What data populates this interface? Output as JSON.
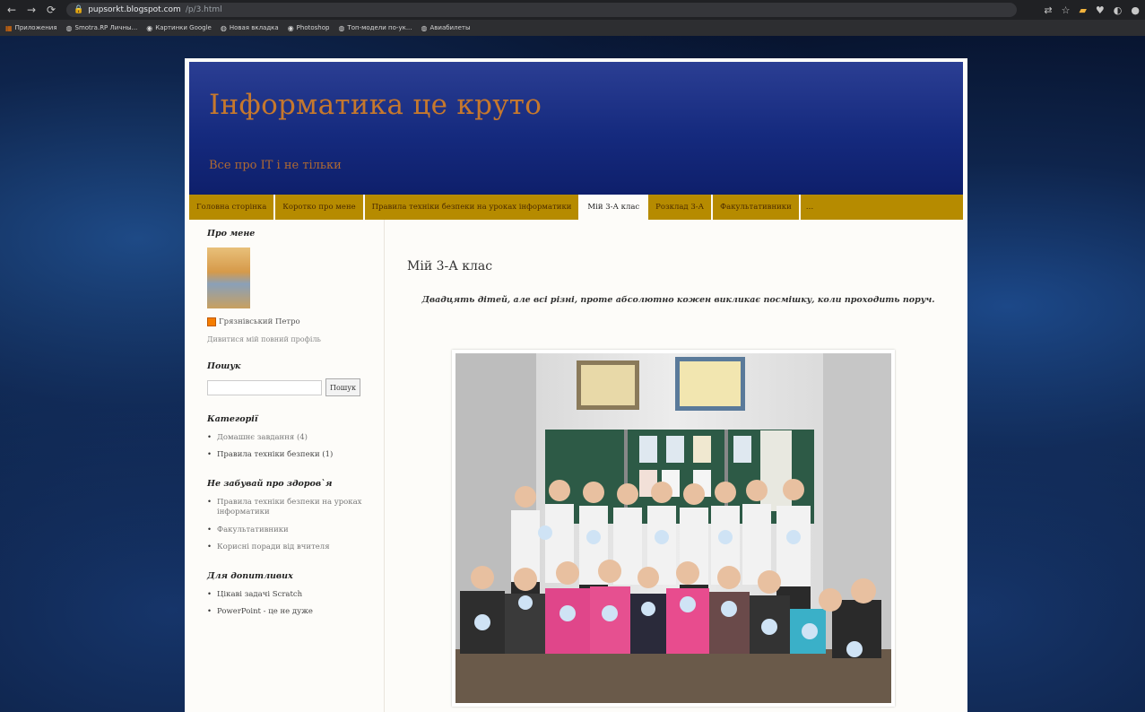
{
  "browser": {
    "url_host": "pupsorkt.blogspot.com",
    "url_path": "/p/3.html",
    "bookmarks": [
      {
        "icon": "apps-icon",
        "label": "Приложения"
      },
      {
        "icon": "globe-icon",
        "label": "Smotra.RP Личны..."
      },
      {
        "icon": "google-icon",
        "label": "Картинки Google"
      },
      {
        "icon": "globe-icon",
        "label": "Новая вкладка"
      },
      {
        "icon": "photoshop-icon",
        "label": "Photoshop"
      },
      {
        "icon": "globe-icon",
        "label": "Топ-модели по-ук..."
      },
      {
        "icon": "globe-icon",
        "label": "Авиабилеты"
      }
    ]
  },
  "blog": {
    "title": "Інформатика це круто",
    "description": "Все про ІТ і не тільки"
  },
  "tabs": [
    {
      "label": "Головна сторінка",
      "active": false
    },
    {
      "label": "Коротко про мене",
      "active": false
    },
    {
      "label": "Правила техніки безпеки на уроках інформатики",
      "active": false
    },
    {
      "label": "Мій 3-А клас",
      "active": true
    },
    {
      "label": "Розклад 3-А",
      "active": false
    },
    {
      "label": "Факультативники",
      "active": false
    },
    {
      "label": "…",
      "active": false
    }
  ],
  "sidebar": {
    "about": {
      "title": "Про мене",
      "name": "Грязнівський Петро",
      "profile_link": "Дивитися мій повний профіль"
    },
    "search": {
      "title": "Пошук",
      "button": "Пошук"
    },
    "categories": {
      "title": "Категорії",
      "items": [
        "Домашнє завдання (4)",
        "Правила техніки безпеки (1)"
      ]
    },
    "health": {
      "title": "Не забувай про здоров`я",
      "items": [
        "Правила техніки безпеки на уроках інформатики",
        "Факультативники",
        "Корисні поради від вчителя"
      ]
    },
    "students": {
      "title": "Для допитливих",
      "items": [
        "Цікаві задачі Scratch",
        "PowerPoint - це не дуже"
      ]
    }
  },
  "post": {
    "title": "Мій 3-А клас",
    "intro": "Двадцять дітей, але всі різні, проте абсолютно кожен викликає посмішку, коли проходить поруч."
  }
}
